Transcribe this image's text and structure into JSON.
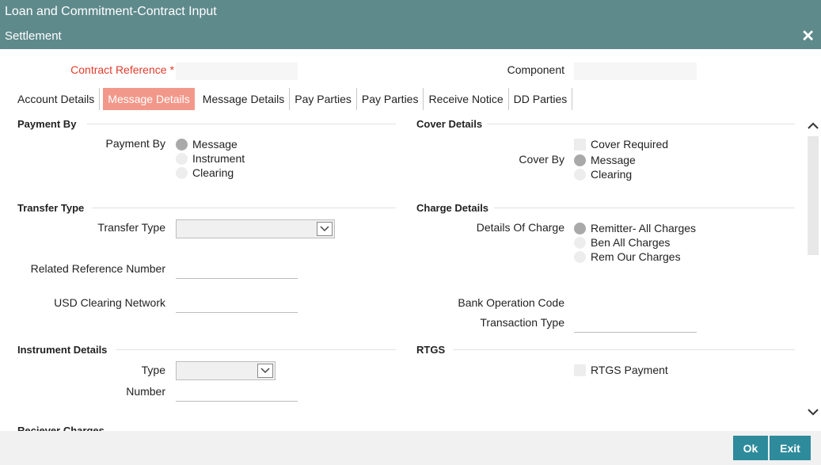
{
  "window": {
    "title": "Loan and Commitment-Contract Input",
    "subtitle": "Settlement",
    "close_glyph": "✕"
  },
  "header": {
    "contract_reference_label": "Contract Reference",
    "required_star": "*",
    "contract_reference_value": "",
    "component_label": "Component",
    "component_value": ""
  },
  "tabs": [
    {
      "label": "Account Details",
      "active": false
    },
    {
      "label": "Message Details",
      "active": true
    },
    {
      "label": "Message Details",
      "active": false
    },
    {
      "label": "Pay Parties",
      "active": false
    },
    {
      "label": "Pay Parties",
      "active": false
    },
    {
      "label": "Receive Notice",
      "active": false
    },
    {
      "label": "DD Parties",
      "active": false
    }
  ],
  "payment_by": {
    "section_title": "Payment By",
    "label": "Payment By",
    "options": [
      {
        "label": "Message",
        "checked": true
      },
      {
        "label": "Instrument",
        "checked": false
      },
      {
        "label": "Clearing",
        "checked": false
      }
    ]
  },
  "cover_details": {
    "section_title": "Cover Details",
    "cover_required_label": "Cover Required",
    "cover_required_checked": false,
    "cover_by_label": "Cover By",
    "options": [
      {
        "label": "Message",
        "checked": true
      },
      {
        "label": "Clearing",
        "checked": false
      }
    ]
  },
  "transfer_type": {
    "section_title": "Transfer Type",
    "transfer_type_label": "Transfer Type",
    "transfer_type_value": "",
    "related_reference_label": "Related Reference Number",
    "related_reference_value": "",
    "usd_clearing_label": "USD Clearing Network",
    "usd_clearing_value": ""
  },
  "charge_details": {
    "section_title": "Charge Details",
    "details_of_charge_label": "Details Of Charge",
    "options": [
      {
        "label": "Remitter- All Charges",
        "checked": true
      },
      {
        "label": "Ben All Charges",
        "checked": false
      },
      {
        "label": "Rem Our Charges",
        "checked": false
      }
    ],
    "bank_operation_code_label": "Bank Operation Code",
    "bank_operation_code_value": "",
    "transaction_type_label": "Transaction Type",
    "transaction_type_value": ""
  },
  "instrument_details": {
    "section_title": "Instrument Details",
    "type_label": "Type",
    "type_value": "",
    "number_label": "Number",
    "number_value": ""
  },
  "rtgs": {
    "section_title": "RTGS",
    "rtgs_payment_label": "RTGS Payment",
    "rtgs_payment_checked": false
  },
  "receiver_charges": {
    "section_title": "Reciever Charges"
  },
  "footer": {
    "ok_label": "Ok",
    "exit_label": "Exit"
  },
  "colors": {
    "title_bar": "#5f8a8c",
    "active_tab": "#f2988a",
    "button": "#2e8b9c",
    "required": "#e23b2a"
  }
}
